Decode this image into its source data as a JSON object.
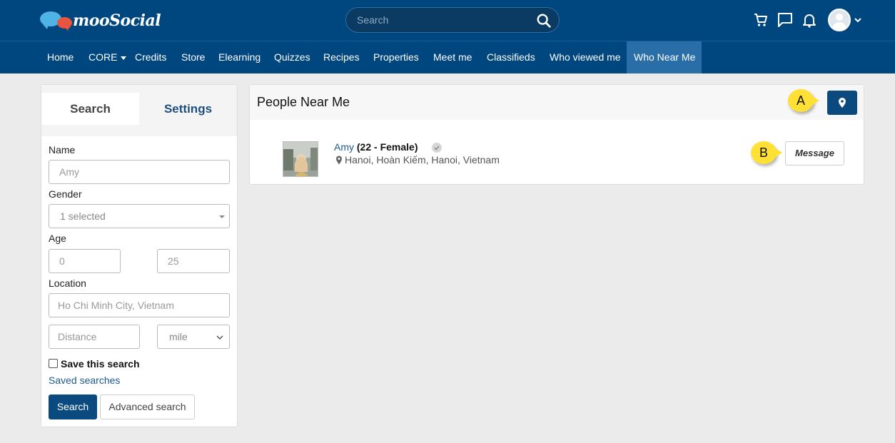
{
  "header": {
    "logo_text": "mooSocial",
    "search_placeholder": "Search"
  },
  "nav": {
    "items": [
      {
        "label": "Home"
      },
      {
        "label": "CORE"
      },
      {
        "label": "Credits"
      },
      {
        "label": "Store"
      },
      {
        "label": "Elearning"
      },
      {
        "label": "Quizzes"
      },
      {
        "label": "Recipes"
      },
      {
        "label": "Properties"
      },
      {
        "label": "Meet me"
      },
      {
        "label": "Classifieds"
      },
      {
        "label": "Who viewed me"
      },
      {
        "label": "Who Near Me"
      }
    ],
    "active": "Who Near Me"
  },
  "left": {
    "tabs": {
      "search": "Search",
      "settings": "Settings"
    },
    "name_label": "Name",
    "name_placeholder": "Amy",
    "gender_label": "Gender",
    "gender_value": "1 selected",
    "age_label": "Age",
    "age_min_placeholder": "0",
    "age_max_placeholder": "25",
    "location_label": "Location",
    "location_placeholder": "Ho Chi Minh City, Vietnam",
    "distance_placeholder": "Distance",
    "unit_value": "mile",
    "save_search_label": "Save this search",
    "saved_searches_link": "Saved searches",
    "search_button": "Search",
    "advanced_button": "Advanced search"
  },
  "main": {
    "title": "People Near Me",
    "results": [
      {
        "name": "Amy",
        "details": "(22 - Female)",
        "location": "Hanoi, Hoàn Kiếm, Hanoi, Vietnam",
        "action": "Message"
      }
    ]
  },
  "callouts": {
    "a": "A",
    "b": "B"
  },
  "colors": {
    "header_bg": "#00467f",
    "nav_active": "#2a6ea8",
    "link": "#1c5a91",
    "callout": "#ffe135"
  }
}
